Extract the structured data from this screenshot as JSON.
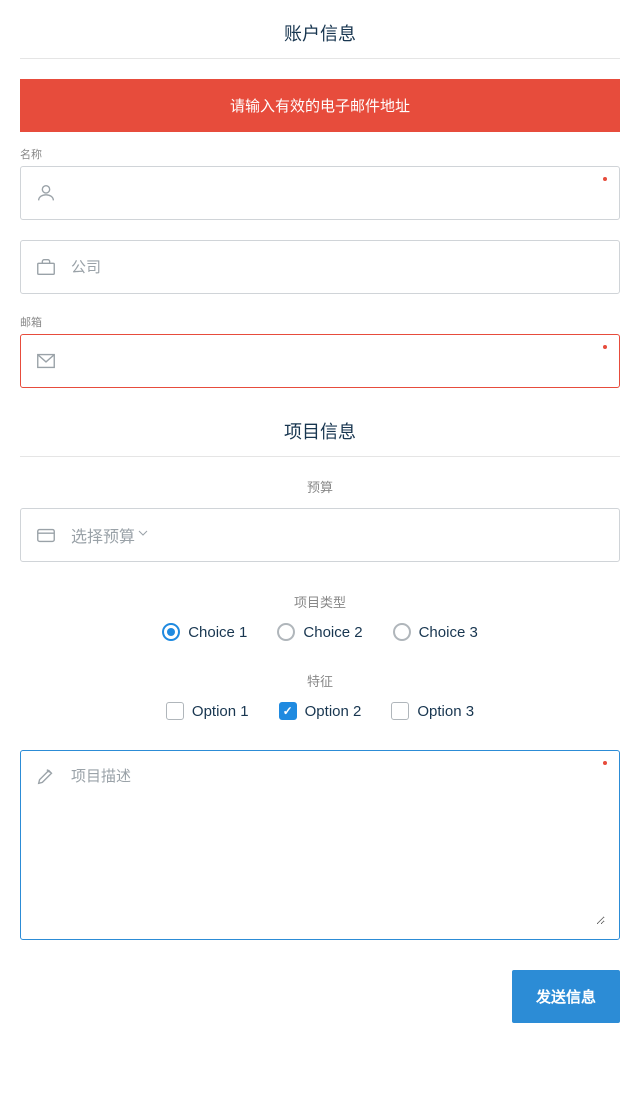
{
  "sections": {
    "account": {
      "title": "账户信息"
    },
    "project": {
      "title": "项目信息"
    }
  },
  "error": {
    "message": "请输入有效的电子邮件地址"
  },
  "fields": {
    "name": {
      "label": "名称",
      "value": "",
      "placeholder": ""
    },
    "company": {
      "label": "",
      "value": "",
      "placeholder": "公司"
    },
    "email": {
      "label": "邮箱",
      "value": "",
      "placeholder": ""
    }
  },
  "budget": {
    "label": "预算",
    "placeholder": "选择预算"
  },
  "projectType": {
    "label": "项目类型",
    "options": [
      "Choice 1",
      "Choice 2",
      "Choice 3"
    ],
    "selected": 0
  },
  "features": {
    "label": "特征",
    "options": [
      "Option 1",
      "Option 2",
      "Option 3"
    ],
    "checked": [
      false,
      true,
      false
    ]
  },
  "description": {
    "placeholder": "项目描述",
    "value": ""
  },
  "submit": {
    "label": "发送信息"
  }
}
